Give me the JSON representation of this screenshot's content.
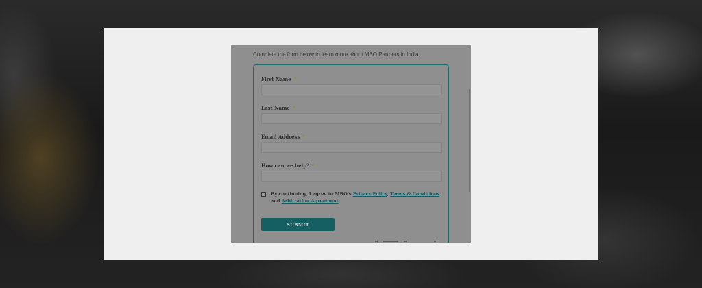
{
  "form": {
    "intro": "Complete the form below to learn more about MBO Partners in India.",
    "fields": [
      {
        "label": "First Name",
        "required_mark": "*",
        "value": ""
      },
      {
        "label": "Last Name",
        "required_mark": "*",
        "value": ""
      },
      {
        "label": "Email Address",
        "required_mark": "*",
        "value": ""
      },
      {
        "label": "How can we help?",
        "required_mark": "*",
        "value": ""
      }
    ],
    "consent": {
      "checked": false,
      "text_before": "By continuing, I agree to MBO's",
      "privacy_link": "Privacy Policy",
      "separator": ",",
      "terms_link": "Terms & Conditions",
      "and_text": "and",
      "arbitration_link": "Arbitration Agreement"
    },
    "submit_label": "SUBMIT"
  },
  "colors": {
    "accent": "#155f63",
    "required": "#9a8a2e"
  }
}
